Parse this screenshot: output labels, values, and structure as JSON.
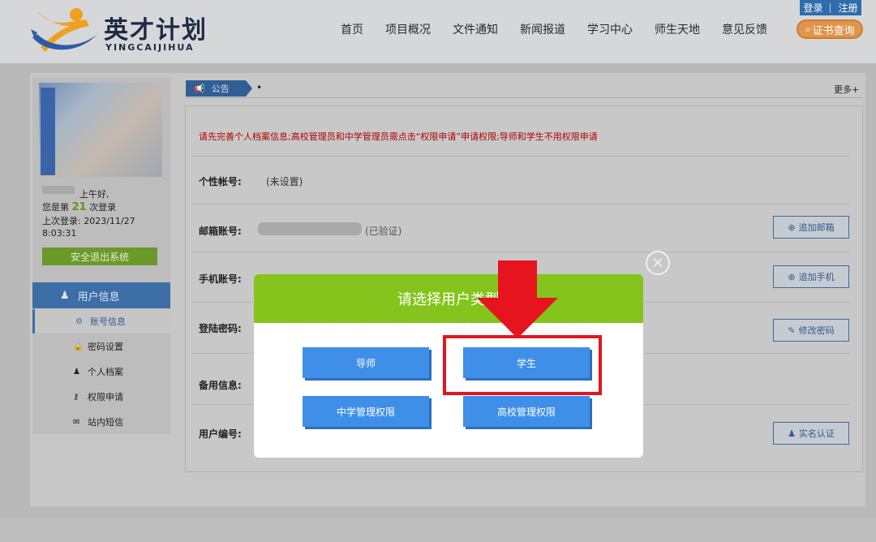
{
  "brand": {
    "title": "英才计划",
    "subtitle": "YINGCAIJIHUA"
  },
  "nav": [
    "首页",
    "项目概况",
    "文件通知",
    "新闻报道",
    "学习中心",
    "师生天地",
    "意见反馈"
  ],
  "auth": {
    "login": "登录",
    "register": "注册"
  },
  "cert_button": "证书查询",
  "user": {
    "greeting": "上午好,",
    "login_count_prefix": "您是第",
    "login_count": "21",
    "login_count_suffix": "次登录",
    "last_login_label": "上次登录:",
    "last_login_date": "2023/11/27",
    "last_login_time": "8:03:31",
    "logout": "安全退出系统"
  },
  "sidebar": {
    "header": "用户信息",
    "items": [
      {
        "label": "账号信息",
        "icon": "gear-icon"
      },
      {
        "label": "密码设置",
        "icon": "lock-icon"
      },
      {
        "label": "个人档案",
        "icon": "person-icon"
      },
      {
        "label": "权限申请",
        "icon": "key-icon"
      },
      {
        "label": "站内短信",
        "icon": "mail-icon"
      }
    ]
  },
  "notice": {
    "tag": "公告",
    "dot": "•",
    "more": "更多+"
  },
  "warning": "请先完善个人档案信息;高校管理员和中学管理员需点击“权限申请”申请权限;导师和学生不用权限申请",
  "fields": {
    "nickname_label": "个性帐号:",
    "nickname_value": "(未设置)",
    "email_label": "邮箱账号:",
    "email_status": "(已验证)",
    "email_btn": "追加邮箱",
    "phone_label": "手机账号:",
    "phone_btn": "追加手机",
    "password_label": "登陆密码:",
    "password_btn": "修改密码",
    "backup_label": "备用信息:",
    "userid_label": "用户编号:",
    "verify_btn": "实名认证"
  },
  "modal": {
    "title": "请选择用户类型",
    "options": [
      "导师",
      "学生",
      "中学管理权限",
      "高校管理权限"
    ],
    "close": "✕"
  },
  "colors": {
    "accent_red": "#e5141e",
    "modal_green": "#84c41c",
    "option_blue": "#3f8fe8"
  }
}
